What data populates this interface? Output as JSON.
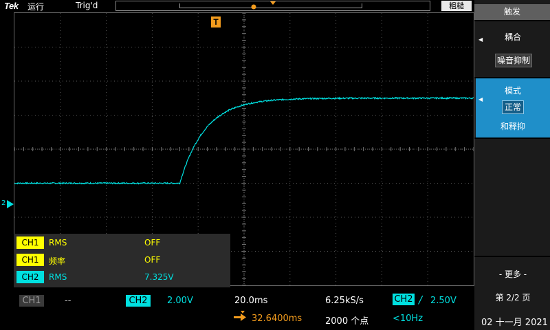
{
  "top_bar": {
    "brand": "Tek",
    "run_state": "运行",
    "trigger_status": "Trig'd",
    "acquire_mode_button": "粗糙"
  },
  "overlay": {
    "trigger_marker": "T",
    "channel_ref": "2"
  },
  "measurements": [
    {
      "channel": "CH1",
      "name": "RMS",
      "value": "OFF",
      "color": "#ffff00"
    },
    {
      "channel": "CH1",
      "name": "频率",
      "value": "OFF",
      "color": "#ffff00"
    },
    {
      "channel": "CH2",
      "name": "RMS",
      "value": "7.325V",
      "color": "#00e0e0"
    }
  ],
  "bottom_bar": {
    "ch1_label": "CH1",
    "ch1_scale": "--",
    "ch2_label": "CH2",
    "ch2_scale": "2.00V",
    "timebase": "20.0ms",
    "sample_rate": "6.25kS/s",
    "trigger_channel": "CH2",
    "trigger_slope": "/",
    "trigger_level": "2.50V",
    "trigger_position": "32.6400ms",
    "record_length": "2000 个点",
    "trigger_frequency": "<10Hz",
    "date": "02 十一月 2021"
  },
  "side_menu": {
    "title": "触发",
    "coupling_label": "耦合",
    "coupling_value": "噪音抑制",
    "mode_label": "模式",
    "mode_value": "正常",
    "mode_sub": "和释抑",
    "more_label": "- 更多 -",
    "page_label": "第 2/2 页"
  },
  "colors": {
    "ch1": "#ffff00",
    "ch2": "#00e0e0",
    "trigger": "#f29b1d",
    "menu_active": "#1f8fc9"
  },
  "waveform": {
    "channel": "CH2",
    "shape": "exponential-rise step",
    "baseline_divisions": -1.0,
    "final_divisions": 1.5,
    "step_time_divisions_from_left": 3.6,
    "time_constant_divisions": 0.55
  }
}
